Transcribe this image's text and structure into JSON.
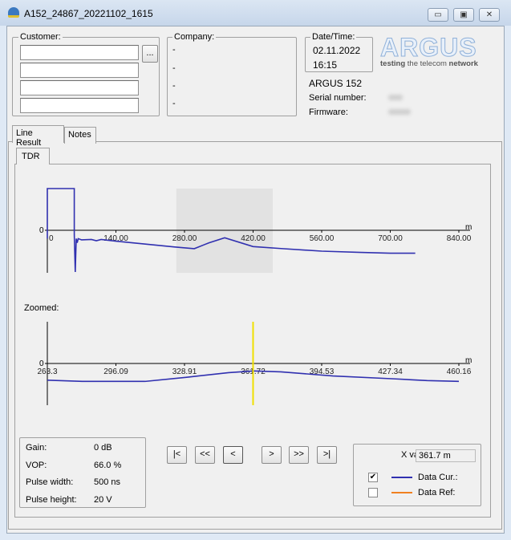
{
  "window": {
    "title": "A152_24867_20221102_1615",
    "min": "▭",
    "max": "▣",
    "close": "✕"
  },
  "customer": {
    "label": "Customer:",
    "fields": [
      "",
      "",
      "",
      ""
    ],
    "browse": "..."
  },
  "company": {
    "label": "Company:",
    "lines": [
      "-",
      "-",
      "-",
      "-"
    ]
  },
  "datetime": {
    "label": "Date/Time:",
    "date": "02.11.2022",
    "time": "16:15"
  },
  "logo": {
    "brand": "ARGUS",
    "tagline_a": "testing",
    "tagline_b": " the telecom ",
    "tagline_c": "network"
  },
  "device": {
    "model": "ARGUS 152",
    "serial_label": "Serial number:",
    "firmware_label": "Firmware:"
  },
  "tabs": [
    {
      "label": "Line Result",
      "active": true
    },
    {
      "label": "Notes",
      "active": false
    }
  ],
  "subtabs": [
    {
      "label": "TDR",
      "active": true
    }
  ],
  "zoomed_label": "Zoomed:",
  "info": [
    {
      "label": "Gain:",
      "value": "0 dB"
    },
    {
      "label": "VOP:",
      "value": "66.0 %"
    },
    {
      "label": "Pulse width:",
      "value": "500 ns"
    },
    {
      "label": "Pulse height:",
      "value": "20 V"
    }
  ],
  "nav": [
    {
      "name": "first",
      "label": "|<"
    },
    {
      "name": "fast-back",
      "label": "<<"
    },
    {
      "name": "back",
      "label": "<"
    },
    {
      "name": "forward",
      "label": ">"
    },
    {
      "name": "fast-forward",
      "label": ">>"
    },
    {
      "name": "last",
      "label": ">|"
    }
  ],
  "legend": {
    "x_value_label": "X value:",
    "x_value": "361.7 m",
    "items": [
      {
        "label": "Data Cur.:",
        "checked": true,
        "color": "#3030b0"
      },
      {
        "label": "Data Ref:",
        "checked": false,
        "color": "#f08020"
      }
    ]
  },
  "chart_data": [
    {
      "type": "line",
      "title": "",
      "xlabel": "m",
      "ylabel": "",
      "xlim": [
        0,
        840
      ],
      "x_ticks": [
        "0",
        "140.00",
        "280.00",
        "420.00",
        "560.00",
        "700.00",
        "840.00"
      ],
      "y_ticks": [
        "0"
      ],
      "highlight_range": [
        263.3,
        460.16
      ],
      "series": [
        {
          "color": "#3030b0",
          "points": [
            [
              0,
              -0.2
            ],
            [
              0,
              1
            ],
            [
              55,
              1
            ],
            [
              55,
              -0.1
            ],
            [
              57,
              -1
            ],
            [
              59,
              -0.2
            ],
            [
              61,
              -0.3
            ],
            [
              63,
              -0.2
            ],
            [
              70,
              -0.23
            ],
            [
              90,
              -0.22
            ],
            [
              100,
              -0.25
            ],
            [
              110,
              -0.22
            ],
            [
              140,
              -0.26
            ],
            [
              200,
              -0.33
            ],
            [
              260,
              -0.4
            ],
            [
              300,
              -0.44
            ],
            [
              330,
              -0.3
            ],
            [
              362,
              -0.18
            ],
            [
              420,
              -0.39
            ],
            [
              480,
              -0.44
            ],
            [
              560,
              -0.5
            ],
            [
              640,
              -0.53
            ],
            [
              700,
              -0.55
            ],
            [
              751,
              -0.55
            ]
          ]
        }
      ]
    },
    {
      "type": "line",
      "title": "",
      "xlabel": "m",
      "ylabel": "",
      "xlim": [
        263.3,
        460.16
      ],
      "x_ticks": [
        "263.3",
        "296.09",
        "328.91",
        "361.72",
        "394.53",
        "427.34",
        "460.16"
      ],
      "y_ticks": [
        "0"
      ],
      "cursor_x": 361.72,
      "cursor_color": "#f0e000",
      "series": [
        {
          "color": "#3030b0",
          "points": [
            [
              263.3,
              -0.4
            ],
            [
              280,
              -0.43
            ],
            [
              310,
              -0.43
            ],
            [
              330,
              -0.33
            ],
            [
              350,
              -0.22
            ],
            [
              362,
              -0.18
            ],
            [
              375,
              -0.2
            ],
            [
              400,
              -0.3
            ],
            [
              430,
              -0.37
            ],
            [
              445,
              -0.41
            ],
            [
              460.16,
              -0.43
            ]
          ]
        }
      ]
    }
  ]
}
